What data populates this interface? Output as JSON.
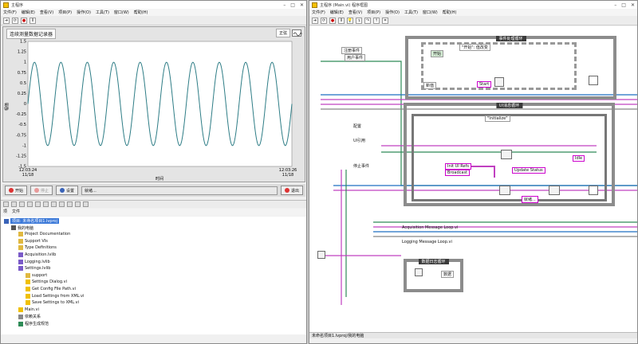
{
  "main_window": {
    "title": "主程序",
    "menus": [
      "文件(F)",
      "编辑(E)",
      "查看(V)",
      "项目(P)",
      "操作(O)",
      "工具(T)",
      "窗口(W)",
      "帮助(H)"
    ],
    "chart_title": "连续测量数据记录器",
    "legend_label": "正弦",
    "buttons": {
      "start": "开始",
      "stop": "停止",
      "settings": "设置",
      "exit": "退出"
    },
    "status_text": "就绪..."
  },
  "chart_data": {
    "type": "line",
    "ylabel": "幅值",
    "xlabel": "时间",
    "ylim": [
      -1.5,
      1.5
    ],
    "yticks": [
      "1.5",
      "1.25",
      "1",
      "0.75",
      "0.5",
      "0.25",
      "0",
      "-0.25",
      "-0.5",
      "-0.75",
      "-1",
      "-1.25",
      "-1.5"
    ],
    "x_start_label": "12:03:24",
    "x_start_date": "11/18",
    "x_end_label": "12:03:26",
    "x_end_date": "11/18",
    "series": [
      {
        "cycles": 10,
        "amplitude": 1,
        "color": "#2e7d86"
      }
    ]
  },
  "project": {
    "tabs": [
      "项",
      "文件"
    ],
    "items": [
      {
        "depth": 0,
        "label": "项目: 未命名项目1.lvproj",
        "icon": "project-icon",
        "selected": true
      },
      {
        "depth": 1,
        "label": "我的电脑",
        "icon": "computer-icon"
      },
      {
        "depth": 2,
        "label": "Project Documentation",
        "icon": "folder-icon"
      },
      {
        "depth": 2,
        "label": "Support VIs",
        "icon": "folder-icon"
      },
      {
        "depth": 2,
        "label": "Type Definitions",
        "icon": "folder-icon"
      },
      {
        "depth": 2,
        "label": "Acquisition.lvlib",
        "icon": "library-icon"
      },
      {
        "depth": 2,
        "label": "Logging.lvlib",
        "icon": "library-icon"
      },
      {
        "depth": 2,
        "label": "Settings.lvlib",
        "icon": "library-icon"
      },
      {
        "depth": 3,
        "label": "support",
        "icon": "folder-icon"
      },
      {
        "depth": 3,
        "label": "Settings Dialog.vi",
        "icon": "vi-icon"
      },
      {
        "depth": 3,
        "label": "Get Config File Path.vi",
        "icon": "vi-icon"
      },
      {
        "depth": 3,
        "label": "Load Settings from XML.vi",
        "icon": "vi-icon"
      },
      {
        "depth": 3,
        "label": "Save Settings to XML.vi",
        "icon": "vi-icon"
      },
      {
        "depth": 2,
        "label": "Main.vi",
        "icon": "vi-icon"
      },
      {
        "depth": 2,
        "label": "依赖关系",
        "icon": "dependency-icon"
      },
      {
        "depth": 2,
        "label": "程序生成规范",
        "icon": "build-icon"
      }
    ]
  },
  "block_window": {
    "title": "主程序 (Main.vi) 程序框图",
    "menus": [
      "文件(F)",
      "编辑(E)",
      "查看(V)",
      "项目(P)",
      "操作(O)",
      "工具(T)",
      "窗口(W)",
      "帮助(H)"
    ],
    "event_loop_label": "事件处理循环",
    "ui_loop_label": "UI消息循环",
    "message_loop_label": "数据日志循环",
    "register_event": "注册事件",
    "user_event": "用户事件",
    "start_case": "\"开始\": 值改变",
    "start_label": "开始",
    "new_value": "新值",
    "start_tag": "Start",
    "initialize_case": "\"Initialize\"",
    "settings_label": "配置",
    "ui_ref_label": "UI引用",
    "stop_event_label": "停止事件",
    "idle_tag": "Idle",
    "init_ui_refs": "Init UI Refs",
    "broadcast": "Broadcast",
    "update_status": "Update Status",
    "ready": "就绪...",
    "acq_loop": "Acquisition Message Loop.vi",
    "log_loop": "Logging Message Loop.vi",
    "data_label": "数据",
    "path_status": "未命名项目1.lvproj/我的电脑"
  }
}
